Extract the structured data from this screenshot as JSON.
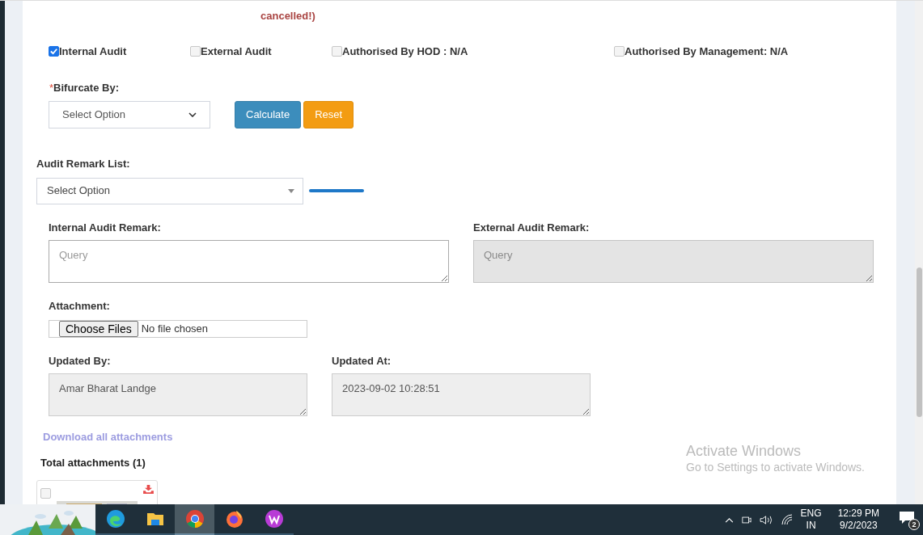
{
  "notice": {
    "text": "cancelled!)"
  },
  "checkboxes": [
    {
      "label": "Internal Audit",
      "checked": true
    },
    {
      "label": "External Audit",
      "checked": false
    },
    {
      "label": "Authorised By HOD : N/A",
      "checked": false
    },
    {
      "label": "Authorised By Management: N/A",
      "checked": false
    }
  ],
  "bifurcate": {
    "required_mark": "*",
    "label": "Bifurcate By:",
    "value": "Select Option"
  },
  "buttons": [
    {
      "label": "Calculate",
      "kind": "primary"
    },
    {
      "label": "Reset",
      "kind": "warning"
    }
  ],
  "audit_remark_list": {
    "label": "Audit Remark List:",
    "value": "Select Option"
  },
  "remarks": [
    {
      "label": "Internal Audit Remark:",
      "placeholder": "Query",
      "disabled": false
    },
    {
      "label": "External Audit Remark:",
      "placeholder": "Query",
      "disabled": true
    }
  ],
  "attachment": {
    "label": "Attachment:",
    "button": "Choose Files",
    "status": "No file chosen"
  },
  "updated": [
    {
      "label": "Updated By:",
      "value": "Amar Bharat Landge"
    },
    {
      "label": "Updated At:",
      "value": "2023-09-02 10:28:51"
    }
  ],
  "download_link": "Download all attachments",
  "total_attachments": "Total attachments (1)",
  "activation": {
    "title": "Activate Windows",
    "text": "Go to Settings to activate Windows."
  },
  "taskbar": {
    "apps": [
      {
        "kind": "edge",
        "selected": false
      },
      {
        "kind": "explorer",
        "selected": false
      },
      {
        "kind": "chrome",
        "selected": true
      },
      {
        "kind": "firefox",
        "selected": false
      },
      {
        "kind": "wps",
        "selected": false
      }
    ],
    "language": [
      "ENG",
      "IN"
    ],
    "time": "12:29 PM",
    "date": "9/2/2023",
    "notifications": "2"
  }
}
